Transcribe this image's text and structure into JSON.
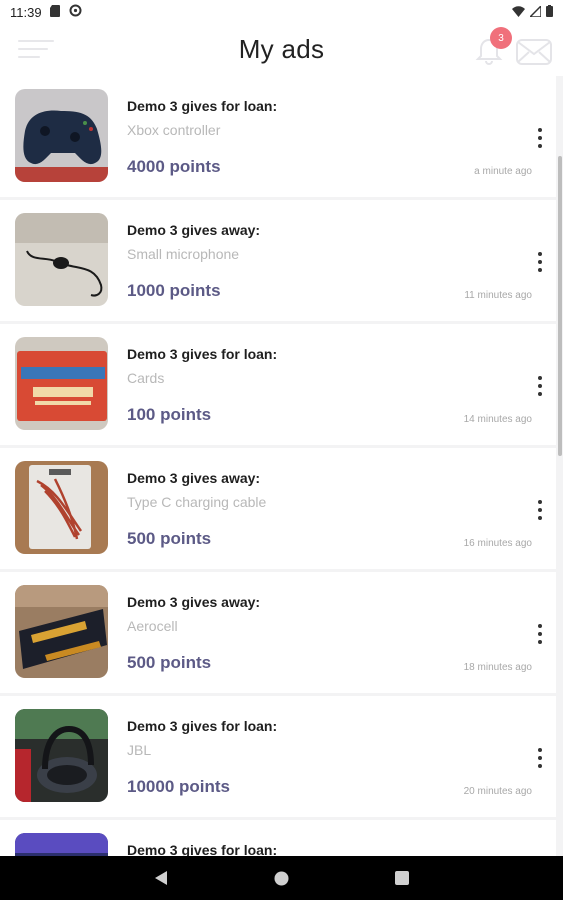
{
  "status_bar": {
    "time": "11:39"
  },
  "app_bar": {
    "title": "My ads",
    "notification_count": "3"
  },
  "colors": {
    "accent": "#5c5a86",
    "badge": "#f0707b",
    "muted": "#b8b8b8"
  },
  "ads": [
    {
      "headline": "Demo 3 gives for loan:",
      "item": "Xbox controller",
      "points": "4000 points",
      "time": "a minute ago",
      "thumb": "xbox-controller"
    },
    {
      "headline": "Demo 3 gives away:",
      "item": "Small microphone",
      "points": "1000 points",
      "time": "11 minutes ago",
      "thumb": "microphone"
    },
    {
      "headline": "Demo 3 gives for loan:",
      "item": "Cards",
      "points": "100 points",
      "time": "14 minutes ago",
      "thumb": "cards"
    },
    {
      "headline": "Demo 3 gives away:",
      "item": "Type C charging cable",
      "points": "500 points",
      "time": "16 minutes ago",
      "thumb": "cable"
    },
    {
      "headline": "Demo 3 gives away:",
      "item": "Aerocell",
      "points": "500 points",
      "time": "18 minutes ago",
      "thumb": "battery"
    },
    {
      "headline": "Demo 3 gives for loan:",
      "item": "JBL",
      "points": "10000 points",
      "time": "20 minutes ago",
      "thumb": "headphones"
    },
    {
      "headline": "Demo 3 gives for loan:",
      "item": "",
      "points": "",
      "time": "",
      "thumb": "partial"
    }
  ]
}
